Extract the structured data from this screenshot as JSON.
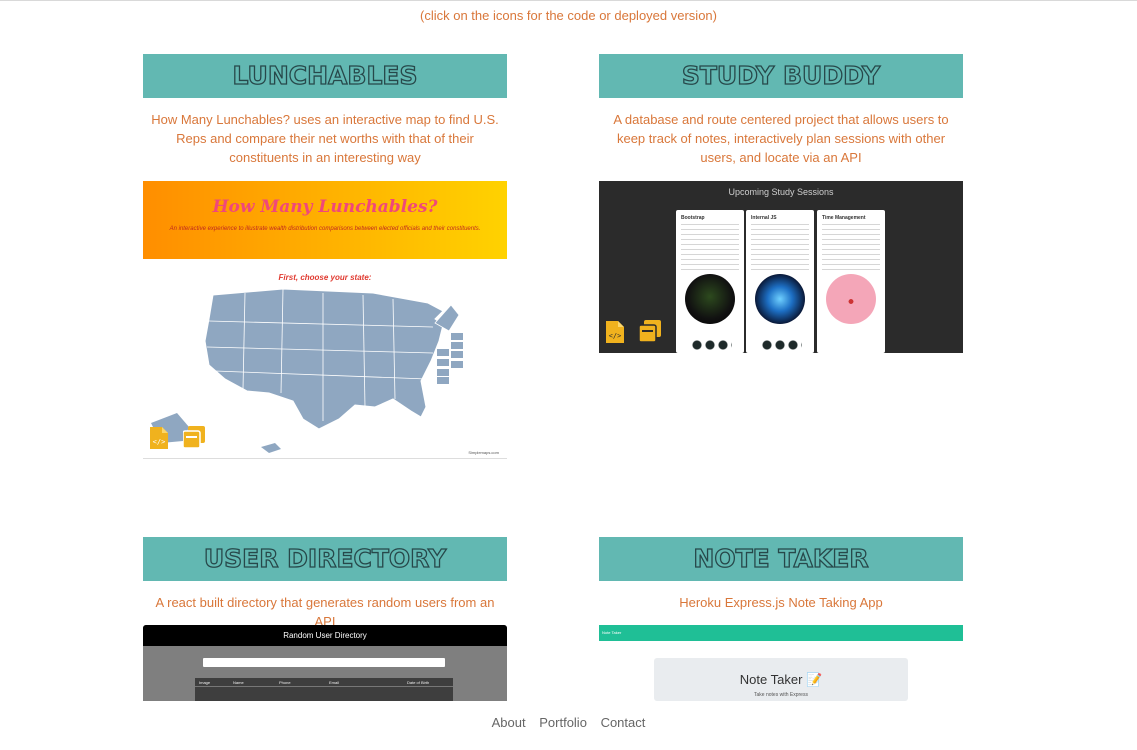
{
  "hint": "(click on the icons for the code or deployed version)",
  "colors": {
    "accent_text": "#d9773a",
    "banner_bg": "#62b8b2",
    "icon": "#f0b21e"
  },
  "projects": [
    {
      "title": "LUNCHABLES",
      "description": "How Many Lunchables? uses an interactive map to find U.S. Reps and compare their net worths with that of their constituents in an interesting way",
      "screenshot": {
        "heading": "How Many Lunchables?",
        "tagline": "An interactive experience to illustrate wealth distribution comparisons between elected officials and their constituents.",
        "prompt": "First, choose your state:",
        "credit": "Simplemaps.com"
      }
    },
    {
      "title": "STUDY BUDDY",
      "description": "A database and route centered project that allows users to keep track of notes, interactively plan sessions with other users, and locate via an API",
      "screenshot": {
        "heading": "Upcoming Study Sessions",
        "cards": [
          "Bootstrap",
          "Internal JS",
          "Time Management"
        ]
      }
    },
    {
      "title": "USER DIRECTORY",
      "description": "A react built directory that generates random users from an API",
      "screenshot": {
        "heading": "Random User Directory",
        "columns": [
          "Image",
          "Name",
          "Phone",
          "Email",
          "Date of Birth"
        ]
      }
    },
    {
      "title": "NOTE TAKER",
      "description": "Heroku Express.js Note Taking App",
      "screenshot": {
        "bar": "Note Taker",
        "heading": "Note Taker 📝",
        "subheading": "Take notes with Express"
      }
    }
  ],
  "icons": [
    "code-file-icon",
    "deployed-copy-icon"
  ],
  "footer": {
    "links": [
      "About",
      "Portfolio",
      "Contact"
    ]
  }
}
